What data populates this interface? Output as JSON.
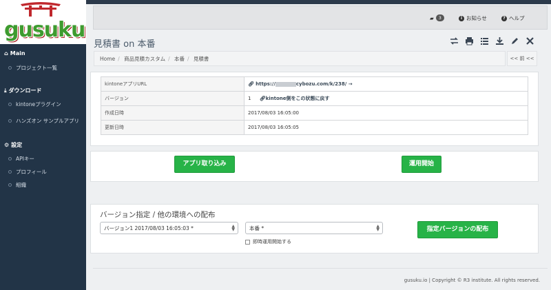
{
  "app": {
    "logo_text": "gusuku"
  },
  "sidebar": {
    "sections": [
      {
        "icon": "home-icon",
        "label": "Main",
        "items": [
          "プロジェクト一覧"
        ]
      },
      {
        "icon": "download-icon",
        "label": "ダウンロード",
        "items": [
          "kintoneプラグイン",
          "ハンズオン サンプルアプリ"
        ]
      },
      {
        "icon": "gear-icon",
        "label": "設定",
        "items": [
          "APIキー",
          "プロフィール",
          "組織"
        ]
      }
    ]
  },
  "topbar": {
    "comments_count": "3",
    "notice_label": "お知らせ",
    "help_label": "ヘルプ"
  },
  "page": {
    "title": "見積書 on 本番",
    "breadcrumb": [
      "Home",
      "商品見積カスタム",
      "本番",
      "見積書"
    ],
    "prev_label": "<< 前 <<",
    "toolbar_icons": [
      "exchange-icon",
      "print-icon",
      "list-icon",
      "download-icon",
      "edit-icon",
      "close-icon"
    ]
  },
  "info_table": {
    "rows": [
      {
        "key": "kintoneアプリURL",
        "value": "https://",
        "value_tail": "cybozu.com/k/238/ →"
      },
      {
        "key": "バージョン",
        "value": "1",
        "value_tail": "kintone側をこの状態に戻す"
      },
      {
        "key": "作成日時",
        "value": "2017/08/03 16:05:00"
      },
      {
        "key": "更新日時",
        "value": "2017/08/03 16:05:05"
      }
    ]
  },
  "actions": {
    "import_label": "アプリ取り込み",
    "start_label": "運用開始"
  },
  "deploy": {
    "title": "バージョン指定 / 他の環境への配布",
    "version_select": "バージョン1 2017/08/03 16:05:03 *",
    "env_select": "本番 *",
    "checkbox_label": "即時運用開始する",
    "deploy_label": "指定バージョンの配布"
  },
  "footer": {
    "text": "gusuku.io | Copyright © R3 institute. All rights reserved."
  },
  "colors": {
    "sidebar_bg": "#223447",
    "accent_green": "#27b347",
    "logo_green": "#3e9b2f",
    "logo_red": "#c0282d"
  }
}
